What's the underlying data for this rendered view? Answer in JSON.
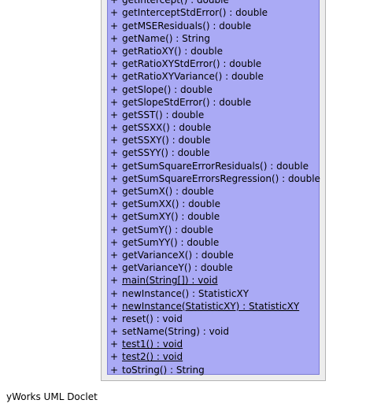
{
  "uml_class": {
    "methods": [
      {
        "visibility": "+",
        "signature": "getIntercept() : double",
        "static": false
      },
      {
        "visibility": "+",
        "signature": "getInterceptStdError() : double",
        "static": false
      },
      {
        "visibility": "+",
        "signature": "getMSEResiduals() : double",
        "static": false
      },
      {
        "visibility": "+",
        "signature": "getName() : String",
        "static": false
      },
      {
        "visibility": "+",
        "signature": "getRatioXY() : double",
        "static": false
      },
      {
        "visibility": "+",
        "signature": "getRatioXYStdError() : double",
        "static": false
      },
      {
        "visibility": "+",
        "signature": "getRatioXYVariance() : double",
        "static": false
      },
      {
        "visibility": "+",
        "signature": "getSlope() : double",
        "static": false
      },
      {
        "visibility": "+",
        "signature": "getSlopeStdError() : double",
        "static": false
      },
      {
        "visibility": "+",
        "signature": "getSST() : double",
        "static": false
      },
      {
        "visibility": "+",
        "signature": "getSSXX() : double",
        "static": false
      },
      {
        "visibility": "+",
        "signature": "getSSXY() : double",
        "static": false
      },
      {
        "visibility": "+",
        "signature": "getSSYY() : double",
        "static": false
      },
      {
        "visibility": "+",
        "signature": "getSumSquareErrorResiduals() : double",
        "static": false
      },
      {
        "visibility": "+",
        "signature": "getSumSquareErrorsRegression() : double",
        "static": false
      },
      {
        "visibility": "+",
        "signature": "getSumX() : double",
        "static": false
      },
      {
        "visibility": "+",
        "signature": "getSumXX() : double",
        "static": false
      },
      {
        "visibility": "+",
        "signature": "getSumXY() : double",
        "static": false
      },
      {
        "visibility": "+",
        "signature": "getSumY() : double",
        "static": false
      },
      {
        "visibility": "+",
        "signature": "getSumYY() : double",
        "static": false
      },
      {
        "visibility": "+",
        "signature": "getVarianceX() : double",
        "static": false
      },
      {
        "visibility": "+",
        "signature": "getVarianceY() : double",
        "static": false
      },
      {
        "visibility": "+",
        "signature": "main(String[]) : void",
        "static": true
      },
      {
        "visibility": "+",
        "signature": "newInstance() : StatisticXY",
        "static": false
      },
      {
        "visibility": "+",
        "signature": "newInstance(StatisticXY) : StatisticXY",
        "static": true
      },
      {
        "visibility": "+",
        "signature": "reset() : void",
        "static": false
      },
      {
        "visibility": "+",
        "signature": "setName(String) : void",
        "static": false
      },
      {
        "visibility": "+",
        "signature": "test1() : void",
        "static": true
      },
      {
        "visibility": "+",
        "signature": "test2() : void",
        "static": true
      },
      {
        "visibility": "+",
        "signature": "toString() : String",
        "static": false
      }
    ]
  },
  "footer": {
    "label": "yWorks UML Doclet"
  },
  "colors": {
    "class_box_fill": "#ededed",
    "class_box_border": "#b4b4b4",
    "methods_fill": "#aaaaf5",
    "methods_border": "#7c7cd4"
  }
}
